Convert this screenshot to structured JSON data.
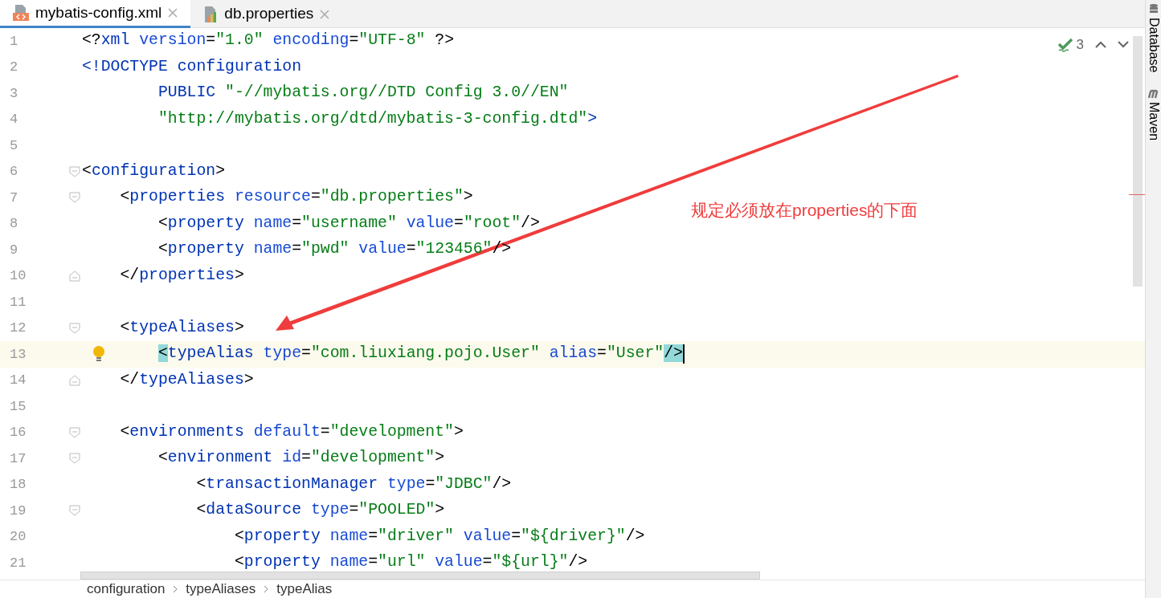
{
  "tabs": [
    {
      "label": "mybatis-config.xml",
      "kind": "xml",
      "selected": true
    },
    {
      "label": "db.properties",
      "kind": "properties",
      "selected": false
    }
  ],
  "inspection": {
    "count": "3"
  },
  "lines": [
    {
      "number": "1",
      "current": false,
      "bulb": false,
      "fold_start": false,
      "fold_end": false,
      "tokens": [
        {
          "kind": "punct",
          "text": "<?"
        },
        {
          "kind": "tag",
          "text": "xml"
        },
        {
          "kind": "attr",
          "text": " version"
        },
        {
          "kind": "punct",
          "text": "="
        },
        {
          "kind": "value",
          "text": "\"1.0\""
        },
        {
          "kind": "attr",
          "text": " encoding"
        },
        {
          "kind": "punct",
          "text": "="
        },
        {
          "kind": "value",
          "text": "\"UTF-8\""
        },
        {
          "kind": "punct",
          "text": " ?>"
        }
      ]
    },
    {
      "number": "2",
      "current": false,
      "bulb": false,
      "fold_start": false,
      "fold_end": false,
      "tokens": [
        {
          "kind": "tag",
          "text": "<!DOCTYPE configuration"
        }
      ]
    },
    {
      "number": "3",
      "current": false,
      "bulb": false,
      "fold_start": false,
      "fold_end": false,
      "tokens": [
        {
          "kind": "tag",
          "text": "        PUBLIC"
        },
        {
          "kind": "value",
          "text": " \"-//mybatis.org//DTD Config 3.0//EN\""
        }
      ]
    },
    {
      "number": "4",
      "current": false,
      "bulb": false,
      "fold_start": false,
      "fold_end": false,
      "tokens": [
        {
          "kind": "value",
          "text": "        \"http://mybatis.org/dtd/mybatis-3-config.dtd\""
        },
        {
          "kind": "tag",
          "text": ">"
        }
      ]
    },
    {
      "number": "5",
      "current": false,
      "bulb": false,
      "fold_start": false,
      "fold_end": false
    },
    {
      "number": "6",
      "current": false,
      "bulb": false,
      "fold_start": true,
      "fold_end": false,
      "tokens": [
        {
          "kind": "punct",
          "text": "<"
        },
        {
          "kind": "tag",
          "text": "configuration"
        },
        {
          "kind": "punct",
          "text": ">"
        }
      ]
    },
    {
      "number": "7",
      "current": false,
      "bulb": false,
      "fold_start": true,
      "fold_end": false,
      "tokens": [
        {
          "kind": "punct",
          "text": "    <"
        },
        {
          "kind": "tag",
          "text": "properties"
        },
        {
          "kind": "attr",
          "text": " resource"
        },
        {
          "kind": "punct",
          "text": "="
        },
        {
          "kind": "value",
          "text": "\"db.properties\""
        },
        {
          "kind": "punct",
          "text": ">"
        }
      ]
    },
    {
      "number": "8",
      "current": false,
      "bulb": false,
      "fold_start": false,
      "fold_end": false,
      "tokens": [
        {
          "kind": "punct",
          "text": "        <"
        },
        {
          "kind": "tag",
          "text": "property"
        },
        {
          "kind": "attr",
          "text": " name"
        },
        {
          "kind": "punct",
          "text": "="
        },
        {
          "kind": "value",
          "text": "\"username\""
        },
        {
          "kind": "attr",
          "text": " value"
        },
        {
          "kind": "punct",
          "text": "="
        },
        {
          "kind": "value",
          "text": "\"root\""
        },
        {
          "kind": "punct",
          "text": "/>"
        }
      ]
    },
    {
      "number": "9",
      "current": false,
      "bulb": false,
      "fold_start": false,
      "fold_end": false,
      "tokens": [
        {
          "kind": "punct",
          "text": "        <"
        },
        {
          "kind": "tag",
          "text": "property"
        },
        {
          "kind": "attr",
          "text": " name"
        },
        {
          "kind": "punct",
          "text": "="
        },
        {
          "kind": "value",
          "text": "\"pwd\""
        },
        {
          "kind": "attr",
          "text": " value"
        },
        {
          "kind": "punct",
          "text": "="
        },
        {
          "kind": "value",
          "text": "\"123456\""
        },
        {
          "kind": "punct",
          "text": "/>"
        }
      ]
    },
    {
      "number": "10",
      "current": false,
      "bulb": false,
      "fold_start": false,
      "fold_end": true,
      "tokens": [
        {
          "kind": "punct",
          "text": "    </"
        },
        {
          "kind": "tag",
          "text": "properties"
        },
        {
          "kind": "punct",
          "text": ">"
        }
      ]
    },
    {
      "number": "11",
      "current": false,
      "bulb": false,
      "fold_start": false,
      "fold_end": false
    },
    {
      "number": "12",
      "current": false,
      "bulb": false,
      "fold_start": true,
      "fold_end": false,
      "tokens": [
        {
          "kind": "punct",
          "text": "    <"
        },
        {
          "kind": "tag",
          "text": "typeAliases"
        },
        {
          "kind": "punct",
          "text": ">"
        }
      ]
    },
    {
      "number": "13",
      "current": true,
      "bulb": true,
      "fold_start": false,
      "fold_end": false,
      "tokens": [
        {
          "kind": "match",
          "text": "        <"
        },
        {
          "kind": "tag",
          "text": "typeAlias"
        },
        {
          "kind": "attr",
          "text": " type"
        },
        {
          "kind": "punct",
          "text": "="
        },
        {
          "kind": "value",
          "text": "\"com.liuxiang.pojo.User\""
        },
        {
          "kind": "attr",
          "text": " alias"
        },
        {
          "kind": "punct",
          "text": "="
        },
        {
          "kind": "value",
          "text": "\"User\""
        },
        {
          "kind": "match",
          "text": "/>"
        }
      ]
    },
    {
      "number": "14",
      "current": false,
      "bulb": false,
      "fold_start": false,
      "fold_end": true,
      "tokens": [
        {
          "kind": "punct",
          "text": "    </"
        },
        {
          "kind": "tag",
          "text": "typeAliases"
        },
        {
          "kind": "punct",
          "text": ">"
        }
      ]
    },
    {
      "number": "15",
      "current": false,
      "bulb": false,
      "fold_start": false,
      "fold_end": false
    },
    {
      "number": "16",
      "current": false,
      "bulb": false,
      "fold_start": true,
      "fold_end": false,
      "tokens": [
        {
          "kind": "punct",
          "text": "    <"
        },
        {
          "kind": "tag",
          "text": "environments"
        },
        {
          "kind": "attr",
          "text": " default"
        },
        {
          "kind": "punct",
          "text": "="
        },
        {
          "kind": "value",
          "text": "\"development\""
        },
        {
          "kind": "punct",
          "text": ">"
        }
      ]
    },
    {
      "number": "17",
      "current": false,
      "bulb": false,
      "fold_start": true,
      "fold_end": false,
      "tokens": [
        {
          "kind": "punct",
          "text": "        <"
        },
        {
          "kind": "tag",
          "text": "environment"
        },
        {
          "kind": "attr",
          "text": " id"
        },
        {
          "kind": "punct",
          "text": "="
        },
        {
          "kind": "value",
          "text": "\"development\""
        },
        {
          "kind": "punct",
          "text": ">"
        }
      ]
    },
    {
      "number": "18",
      "current": false,
      "bulb": false,
      "fold_start": false,
      "fold_end": false,
      "tokens": [
        {
          "kind": "punct",
          "text": "            <"
        },
        {
          "kind": "tag",
          "text": "transactionManager"
        },
        {
          "kind": "attr",
          "text": " type"
        },
        {
          "kind": "punct",
          "text": "="
        },
        {
          "kind": "value",
          "text": "\"JDBC\""
        },
        {
          "kind": "punct",
          "text": "/>"
        }
      ]
    },
    {
      "number": "19",
      "current": false,
      "bulb": false,
      "fold_start": true,
      "fold_end": false,
      "tokens": [
        {
          "kind": "punct",
          "text": "            <"
        },
        {
          "kind": "tag",
          "text": "dataSource"
        },
        {
          "kind": "attr",
          "text": " type"
        },
        {
          "kind": "punct",
          "text": "="
        },
        {
          "kind": "value",
          "text": "\"POOLED\""
        },
        {
          "kind": "punct",
          "text": ">"
        }
      ]
    },
    {
      "number": "20",
      "current": false,
      "bulb": false,
      "fold_start": false,
      "fold_end": false,
      "tokens": [
        {
          "kind": "punct",
          "text": "                <"
        },
        {
          "kind": "tag",
          "text": "property"
        },
        {
          "kind": "attr",
          "text": " name"
        },
        {
          "kind": "punct",
          "text": "="
        },
        {
          "kind": "value",
          "text": "\"driver\""
        },
        {
          "kind": "attr",
          "text": " value"
        },
        {
          "kind": "punct",
          "text": "="
        },
        {
          "kind": "value",
          "text": "\"${driver}\""
        },
        {
          "kind": "punct",
          "text": "/>"
        }
      ]
    },
    {
      "number": "21",
      "current": false,
      "bulb": false,
      "fold_start": false,
      "fold_end": false,
      "tokens": [
        {
          "kind": "punct",
          "text": "                <"
        },
        {
          "kind": "tag",
          "text": "property"
        },
        {
          "kind": "attr",
          "text": " name"
        },
        {
          "kind": "punct",
          "text": "="
        },
        {
          "kind": "value",
          "text": "\"url\""
        },
        {
          "kind": "attr",
          "text": " value"
        },
        {
          "kind": "punct",
          "text": "="
        },
        {
          "kind": "value",
          "text": "\"${url}\""
        },
        {
          "kind": "punct",
          "text": "/>"
        }
      ]
    }
  ],
  "annotation": {
    "text": "规定必须放在properties的下面"
  },
  "side_tools": [
    {
      "label": "Database",
      "kind": "database"
    },
    {
      "label": "Maven",
      "kind": "maven"
    }
  ],
  "breadcrumbs": [
    "configuration",
    "typeAliases",
    "typeAlias"
  ]
}
